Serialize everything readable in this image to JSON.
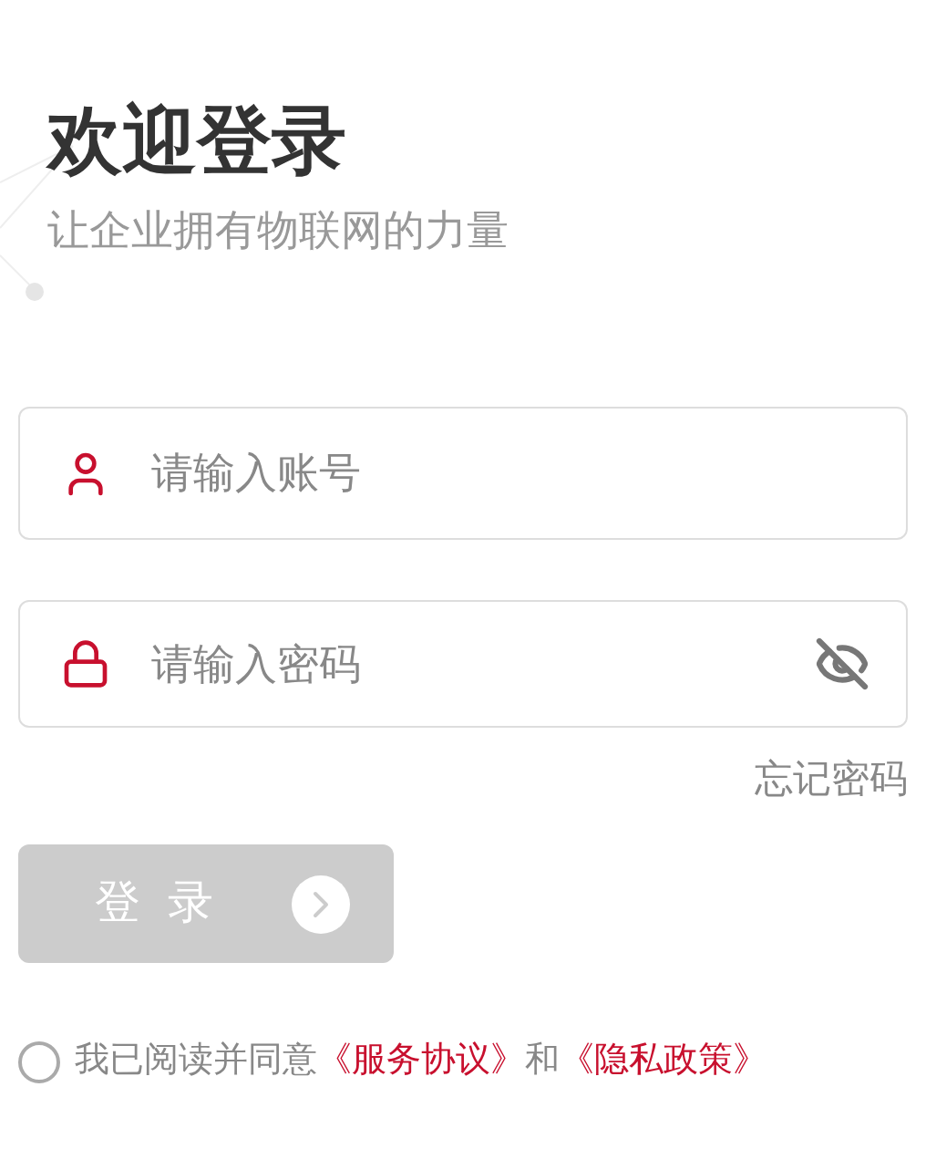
{
  "title": "欢迎登录",
  "subtitle": "让企业拥有物联网的力量",
  "account_field": {
    "placeholder": "请输入账号"
  },
  "password_field": {
    "placeholder": "请输入密码",
    "visible": false
  },
  "forgot_password": "忘记密码",
  "login_button": {
    "label": "登 录",
    "disabled": true
  },
  "agreement": {
    "checked": false,
    "prefix": "我已阅读并同意",
    "links": [
      "《服务协议》",
      "《隐私政策》"
    ],
    "conjunction": "和"
  }
}
